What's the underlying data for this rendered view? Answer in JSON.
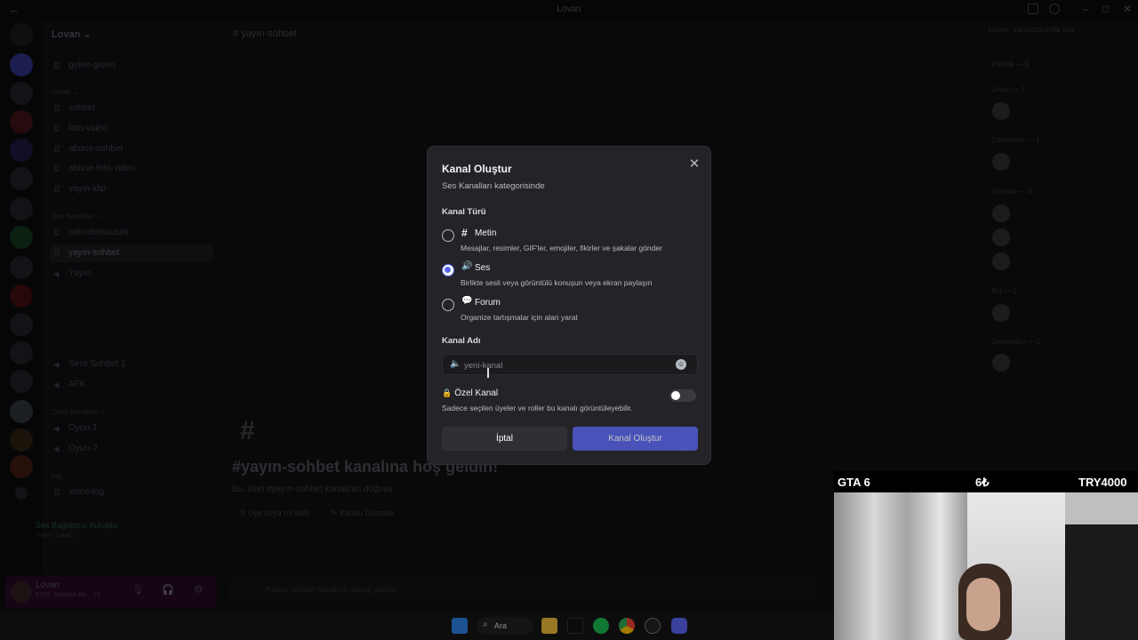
{
  "titlebar": {
    "title": "Lovan"
  },
  "server": {
    "name": "Lovan ⌄"
  },
  "channels": [
    {
      "label": "gelen-giden"
    },
    {
      "label": "sohbet"
    },
    {
      "label": "foto-video"
    },
    {
      "label": "abone-sohbet"
    },
    {
      "label": "abone-foto-video"
    },
    {
      "label": "yayın-klip"
    },
    {
      "label": "mikrofonsuzum"
    },
    {
      "label": "yayın-sohbet"
    },
    {
      "label": "Yayın"
    },
    {
      "label": "Sesli Sohbet 1"
    },
    {
      "label": "AFK"
    },
    {
      "label": "Oyun-1"
    },
    {
      "label": "Oyun-2"
    },
    {
      "label": "voice-log"
    }
  ],
  "categories": {
    "genel": "Genel ⌄",
    "ses": "Ses Kanalları ⌄",
    "oyun": "Oyun Kanalları ⌄",
    "log": "log"
  },
  "voice_status": {
    "title": "Ses Bağlantısı Kuruldu",
    "sub": "Yayın / Lovan"
  },
  "user": {
    "name": "Lovan",
    "status": "K/DA, Madison Be... +1"
  },
  "chat": {
    "channel": "yayın-sohbet",
    "welcome_title": "#yayın-sohbet kanalına hoş geldin!",
    "welcome_sub": "Bu, özel #yayın-sohbet kanalının doğuşu.",
    "add_member": "Üye veya rol ekle",
    "edit_channel": "Kanalı Düzenle",
    "placeholder": "#yayın-sohbet kanalına mesaj gönder"
  },
  "members": {
    "search": "Lovan sunucusunda ara",
    "events": "Etkinlik — 9",
    "groups": [
      "Lovan — 1",
      "Çikolatalar — 1",
      "Yönetici — 3",
      "Bot — 1",
      "Çevrimdışı — 1"
    ]
  },
  "modal": {
    "title": "Kanal Oluştur",
    "subtitle": "Ses Kanalları kategorisinde",
    "type_label": "Kanal Türü",
    "options": [
      {
        "icon": "#",
        "name": "Metin",
        "desc": "Mesajlar, resimler, GIF'ler, emojiler, fikirler ve şakalar gönder",
        "selected": false
      },
      {
        "icon": "🔊",
        "name": "Ses",
        "desc": "Birlikte sesli veya görüntülü konuşun veya ekran paylaşın",
        "selected": true
      },
      {
        "icon": "💬",
        "name": "Forum",
        "desc": "Organize tartışmalar için alan yarat",
        "selected": false
      }
    ],
    "name_label": "Kanal Adı",
    "name_placeholder": "yeni-kanal",
    "private_label": "Özel Kanal",
    "private_desc": "Sadece seçilen üyeler ve roller bu kanalı görüntüleyebilir.",
    "cancel": "İptal",
    "create": "Kanal Oluştur"
  },
  "cam": {
    "left": "GTA 6",
    "mid": "6₺",
    "right": "TRY4000"
  },
  "taskbar": {
    "search": "Ara"
  }
}
